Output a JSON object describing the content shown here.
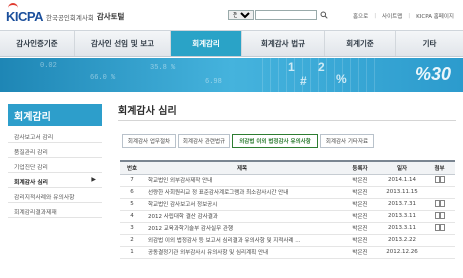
{
  "header": {
    "logo": "KICPA",
    "org": "한국공인회계사회",
    "site": "감사토털",
    "search_scope": "전체",
    "search_value": "",
    "util_links": [
      "홈으로",
      "사이트맵",
      "KICPA 홈페이지"
    ]
  },
  "nav": {
    "items": [
      "감사인증기준",
      "감사인 선임 및 보고",
      "회계감리",
      "회계감사 법규",
      "회계기준",
      "기타"
    ],
    "active": "회계감리"
  },
  "banner": {
    "text": "%30",
    "numbers": [
      "0.02",
      "66.0 %",
      "35.8 %",
      "6.98"
    ],
    "calc": [
      "1",
      "#",
      "2",
      "%"
    ]
  },
  "sidebar": {
    "title": "회계감리",
    "items": [
      {
        "label": "감사보고서 감리",
        "active": false
      },
      {
        "label": "품질관리 감리",
        "active": false
      },
      {
        "label": "기업진단 감리",
        "active": false
      },
      {
        "label": "회계감사 심리",
        "active": true
      },
      {
        "label": "감리지적사례와 유의사항",
        "active": false
      },
      {
        "label": "회계감리결과제재",
        "active": false
      }
    ]
  },
  "main": {
    "title": "회계감사 심리",
    "subtabs": [
      {
        "label": "회계감사 업무절차",
        "active": false
      },
      {
        "label": "회계감사 관련법규",
        "active": false
      },
      {
        "label": "외감법 이외 법정감사 유의사항",
        "active": true
      },
      {
        "label": "회계감사 기타자료",
        "active": false
      }
    ],
    "table": {
      "headers": [
        "번호",
        "제목",
        "등록자",
        "일자",
        "첨부"
      ],
      "rows": [
        {
          "no": "7",
          "title": "학교법인 외부감사제작 안내",
          "author": "박은진",
          "date": "2014.1.14",
          "attach": "첨부"
        },
        {
          "no": "6",
          "title": "선량한 사회원리교 정 표준감사계로그램과 최소감사시간 안내",
          "author": "박은진",
          "date": "2013.11.15",
          "attach": ""
        },
        {
          "no": "5",
          "title": "학교법인 감사보고서 정보공시",
          "author": "박은진",
          "date": "2013.7.31",
          "attach": "첨부"
        },
        {
          "no": "4",
          "title": "2012 사립대학 결산 감사결과",
          "author": "박은진",
          "date": "2013.3.11",
          "attach": "첨부"
        },
        {
          "no": "3",
          "title": "2012 교육과학기술부 감사실무 관행",
          "author": "박은진",
          "date": "2013.3.11",
          "attach": "첨부"
        },
        {
          "no": "2",
          "title": "외감법 이외 법정감사 등 보고서 심리결과 유의사항 및 지적사례 ...",
          "author": "박은진",
          "date": "2013.2.22",
          "attach": ""
        },
        {
          "no": "1",
          "title": "공동결정기관 외부감사시 유의사항 및 심리계획 안내",
          "author": "박은진",
          "date": "2012.12.26",
          "attach": ""
        }
      ]
    }
  },
  "colors": {
    "accent": "#2aa3c7",
    "brand": "#1b4f9c",
    "active_tab_border": "#2e7d32"
  }
}
